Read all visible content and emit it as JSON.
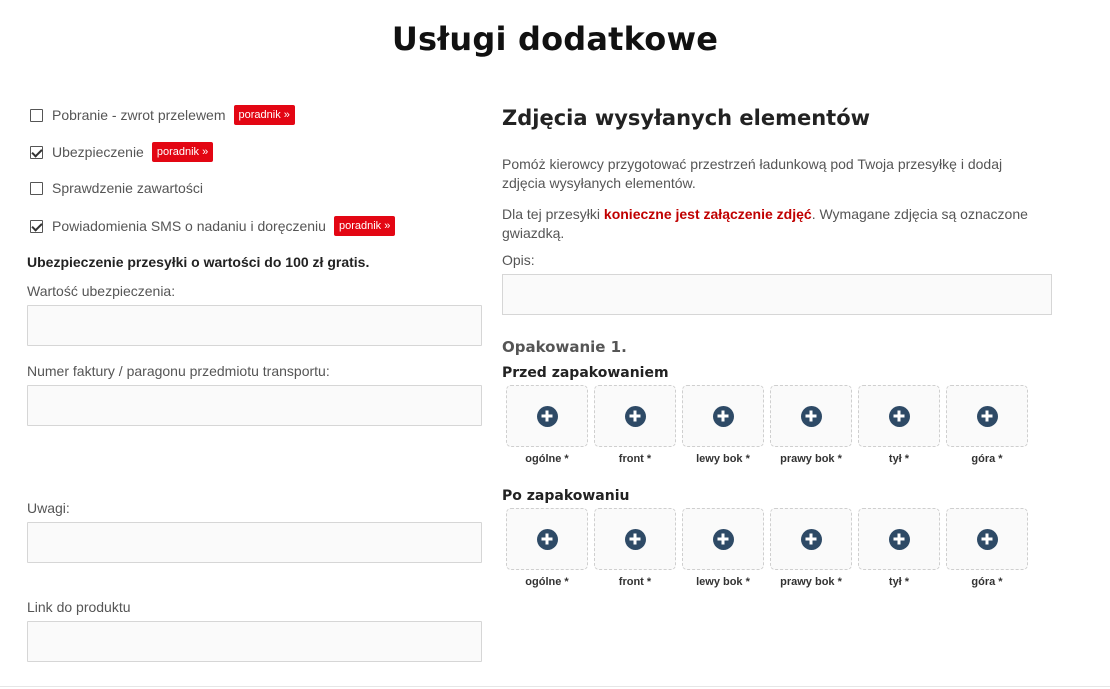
{
  "title": "Usługi dodatkowe",
  "options": [
    {
      "label": "Pobranie - zwrot przelewem",
      "checked": false,
      "badge": "poradnik »"
    },
    {
      "label": "Ubezpieczenie",
      "checked": true,
      "badge": "poradnik »"
    },
    {
      "label": "Sprawdzenie zawartości",
      "checked": false,
      "badge": ""
    },
    {
      "label": "Powiadomienia SMS o nadaniu i doręczeniu",
      "checked": true,
      "badge": "poradnik »"
    }
  ],
  "insurance_note": "Ubezpieczenie przesyłki o wartości do 100 zł gratis.",
  "fields": {
    "insurance_value_label": "Wartość ubezpieczenia:",
    "invoice_label": "Numer faktury / paragonu przedmiotu transportu:",
    "notes_label": "Uwagi:",
    "product_link_label": "Link do produktu"
  },
  "photos": {
    "title": "Zdjęcia wysyłanych elementów",
    "intro": "Pomóż kierowcy przygotować przestrzeń ładunkową pod Twoja przesyłkę i dodaj zdjęcia wysyłanych elementów.",
    "req_prefix": "Dla tej przesyłki ",
    "req_bold": "konieczne jest załączenie zdjęć",
    "req_suffix": ". Wymagane zdjęcia są oznaczone gwiazdką.",
    "desc_label": "Opis:",
    "package_title": "Opakowanie 1.",
    "before_title": "Przed zapakowaniem",
    "after_title": "Po zapakowaniu",
    "slots": [
      "ogólne *",
      "front *",
      "lewy bok *",
      "prawy bok *",
      "tył *",
      "góra *"
    ]
  },
  "colors": {
    "badge": "#e30613",
    "required_text": "#c00000",
    "plus_icon": "#2e4a66"
  },
  "icons": {
    "add_photo": "plus-circle-icon",
    "checkbox_checked": "checkmark-icon"
  }
}
